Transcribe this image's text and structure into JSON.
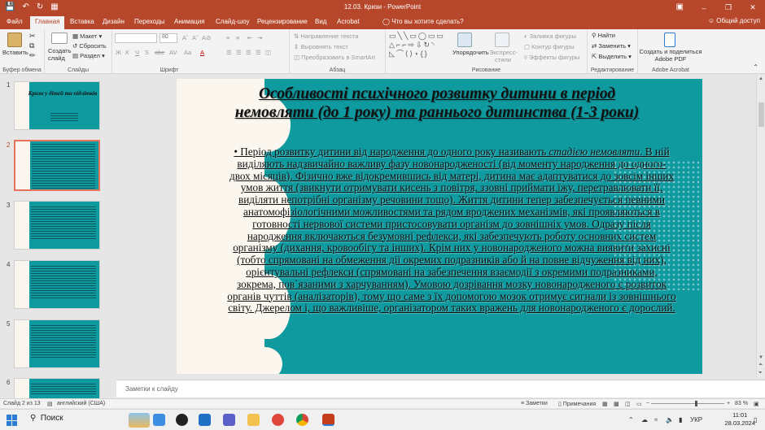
{
  "window": {
    "title": "12.03. Кризи - PowerPoint",
    "qat": [
      "save-icon",
      "undo-icon",
      "redo-icon",
      "slideshow-icon"
    ],
    "controls": [
      "minimize",
      "maximize",
      "close"
    ]
  },
  "tabs": [
    {
      "label": "Файл",
      "active": false
    },
    {
      "label": "Главная",
      "active": true
    },
    {
      "label": "Вставка",
      "active": false
    },
    {
      "label": "Дизайн",
      "active": false
    },
    {
      "label": "Переходы",
      "active": false
    },
    {
      "label": "Анимация",
      "active": false
    },
    {
      "label": "Слайд-шоу",
      "active": false
    },
    {
      "label": "Рецензирование",
      "active": false
    },
    {
      "label": "Вид",
      "active": false
    },
    {
      "label": "Acrobat",
      "active": false
    }
  ],
  "tell_me": "Что вы хотите сделать?",
  "share": "Общий доступ",
  "ribbon": {
    "clipboard": {
      "paste": "Вставить",
      "label": "Буфер обмена"
    },
    "slides": {
      "new_slide": "Создать слайд",
      "layout": "Макет",
      "reset": "Сбросить",
      "section": "Раздел",
      "label": "Слайды"
    },
    "font": {
      "name": "",
      "size": "80",
      "label": "Шрифт",
      "styles": [
        "Ж",
        "К",
        "Ч",
        "S",
        "abc",
        "AV",
        "Aa",
        "A"
      ]
    },
    "paragraph": {
      "text_direction": "Направление текста",
      "align_text": "Выровнять текст",
      "smartart": "Преобразовать в SmartArt",
      "label": "Абзац"
    },
    "drawing": {
      "arrange": "Упорядочить",
      "quick_styles": "Экспресс-стили",
      "fill": "Заливка фигуры",
      "outline": "Контур фигуры",
      "effects": "Эффекты фигуры",
      "label": "Рисование"
    },
    "editing": {
      "find": "Найти",
      "replace": "Заменить",
      "select": "Выделить",
      "label": "Редактирование"
    },
    "acrobat": {
      "create_pdf": "Создать и поделиться Adobe PDF",
      "label": "Adobe Acrobat"
    }
  },
  "thumbnails": [
    {
      "num": "1",
      "title": "Кризи у дітей та підлітків",
      "selected": false
    },
    {
      "num": "2",
      "title": "",
      "selected": true
    },
    {
      "num": "3",
      "title": "",
      "selected": false
    },
    {
      "num": "4",
      "title": "",
      "selected": false
    },
    {
      "num": "5",
      "title": "",
      "selected": false
    },
    {
      "num": "6",
      "title": "",
      "selected": false
    }
  ],
  "slide": {
    "title": "Особливості психічного розвитку дитини в період немовляти (до 1 року) та раннього дитинства (1-3 роки)",
    "body_pre": "• Період розвитку дитини від народження до одного року називають ",
    "body_em": "стадією немовляти",
    "body_post": ". В ній виділяють надзвичайно важливу фазу новонародженості (від моменту народження до одного-двох місяців). Фізично вже відокремившись від матері, дитина має адаптуватися до зовсім інших умов життя (звикнути отримувати кисень з повітря, ззовні приймати їжу, перетравлювати її, виділяти непотрібні організму речовини тощо).  Життя дитини тепер забезпечується певними анатомофізіологічними можливостями та рядом вроджених механізмів, які проявляються в готовності нервової системи пристосовувати організм до зовнішніх умов. Одразу після народження включаються безумовні рефлекси, які забезпечують роботу основних систем організму (дихання, кровообігу та інших). Крім них у новонародженого можна виявити захисні (тобто спрямовані на обмеження дії окремих подразників або й на повне відчуження від них), орієнтувальні рефлекси (спрямовані на забезпечення взаємодії з окремими подразниками, зокрема, пов`язаними з харчуванням).  Умовою дозрівання мозку новонародженого є розвиток органів чуттів (аналізаторів), тому що саме з їх допомогою мозок отримує сигнали із зовнішнього світу. Джерелом і, що важливіше, організатором таких вражень для новонародженого є дорослий."
  },
  "notes_placeholder": "Заметки к слайду",
  "status": {
    "slide_info": "Слайд 2 из 13",
    "language": "английский (США)",
    "notes": "Заметки",
    "comments": "Примечания",
    "zoom": "83 %"
  },
  "taskbar": {
    "search": "Поиск",
    "language": "УКР",
    "time": "11:01",
    "date": "28.03.2024"
  },
  "colors": {
    "accent": "#b7472a",
    "slide_bg": "#0f9aa0",
    "paper": "#fbf7ef"
  }
}
